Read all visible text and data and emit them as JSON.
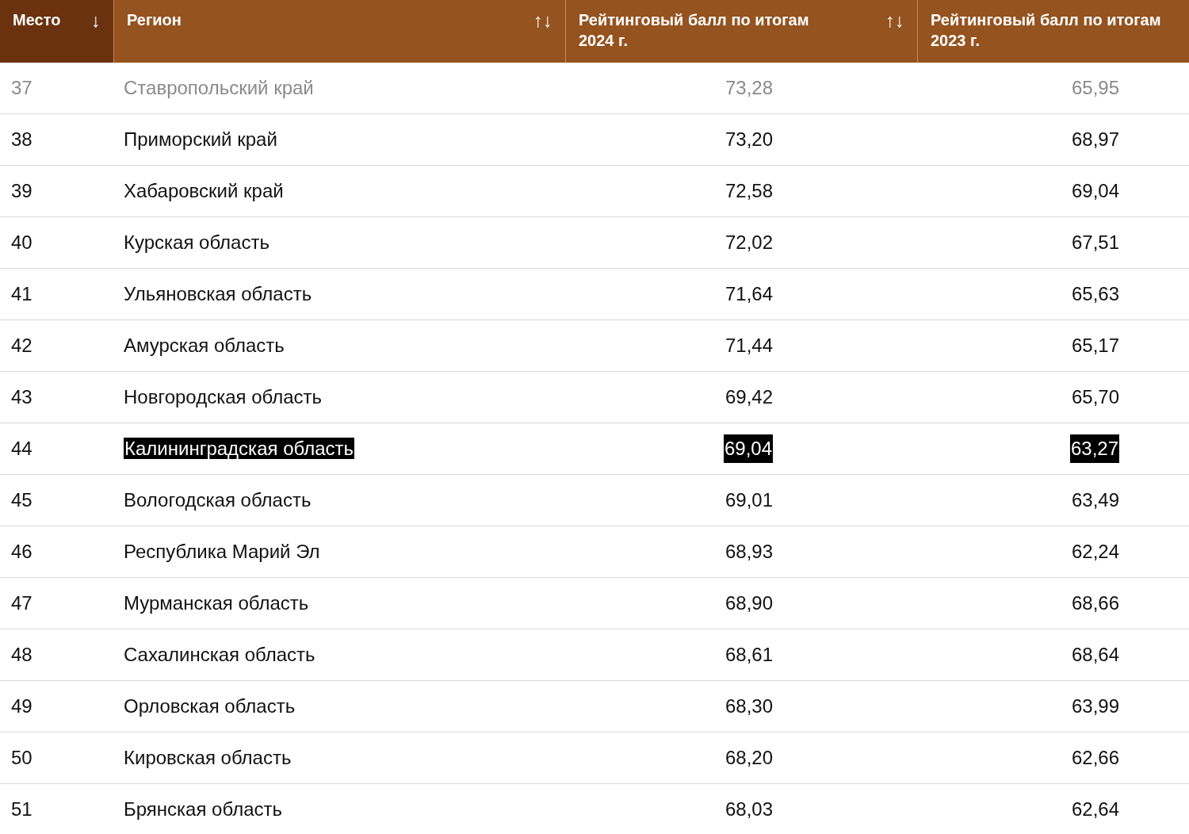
{
  "table": {
    "columns": [
      {
        "label": "Место",
        "sort": "↓",
        "selected": true
      },
      {
        "label": "Регион",
        "sort": "↑↓",
        "selected": false
      },
      {
        "label": "Рейтинговый балл по итогам 2024 г.",
        "sort": "↑↓",
        "selected": false
      },
      {
        "label": "Рейтинговый балл по итогам 2023 г.",
        "selected": false
      }
    ],
    "rows": [
      {
        "place": "37",
        "region": "Ставропольский край",
        "score_2024": "73,28",
        "score_2023": "65,95",
        "dimmed": true,
        "highlighted": false
      },
      {
        "place": "38",
        "region": "Приморский край",
        "score_2024": "73,20",
        "score_2023": "68,97",
        "dimmed": false,
        "highlighted": false
      },
      {
        "place": "39",
        "region": "Хабаровский край",
        "score_2024": "72,58",
        "score_2023": "69,04",
        "dimmed": false,
        "highlighted": false
      },
      {
        "place": "40",
        "region": "Курская область",
        "score_2024": "72,02",
        "score_2023": "67,51",
        "dimmed": false,
        "highlighted": false
      },
      {
        "place": "41",
        "region": "Ульяновская область",
        "score_2024": "71,64",
        "score_2023": "65,63",
        "dimmed": false,
        "highlighted": false
      },
      {
        "place": "42",
        "region": "Амурская область",
        "score_2024": "71,44",
        "score_2023": "65,17",
        "dimmed": false,
        "highlighted": false
      },
      {
        "place": "43",
        "region": "Новгородская область",
        "score_2024": "69,42",
        "score_2023": "65,70",
        "dimmed": false,
        "highlighted": false
      },
      {
        "place": "44",
        "region": "Калининградская область",
        "score_2024": "69,04",
        "score_2023": "63,27",
        "dimmed": false,
        "highlighted": true
      },
      {
        "place": "45",
        "region": "Вологодская область",
        "score_2024": "69,01",
        "score_2023": "63,49",
        "dimmed": false,
        "highlighted": false
      },
      {
        "place": "46",
        "region": "Республика Марий Эл",
        "score_2024": "68,93",
        "score_2023": "62,24",
        "dimmed": false,
        "highlighted": false
      },
      {
        "place": "47",
        "region": "Мурманская область",
        "score_2024": "68,90",
        "score_2023": "68,66",
        "dimmed": false,
        "highlighted": false
      },
      {
        "place": "48",
        "region": "Сахалинская область",
        "score_2024": "68,61",
        "score_2023": "68,64",
        "dimmed": false,
        "highlighted": false
      },
      {
        "place": "49",
        "region": "Орловская область",
        "score_2024": "68,30",
        "score_2023": "63,99",
        "dimmed": false,
        "highlighted": false
      },
      {
        "place": "50",
        "region": "Кировская область",
        "score_2024": "68,20",
        "score_2023": "62,66",
        "dimmed": false,
        "highlighted": false
      },
      {
        "place": "51",
        "region": "Брянская область",
        "score_2024": "68,03",
        "score_2023": "62,64",
        "dimmed": false,
        "highlighted": false
      }
    ]
  }
}
